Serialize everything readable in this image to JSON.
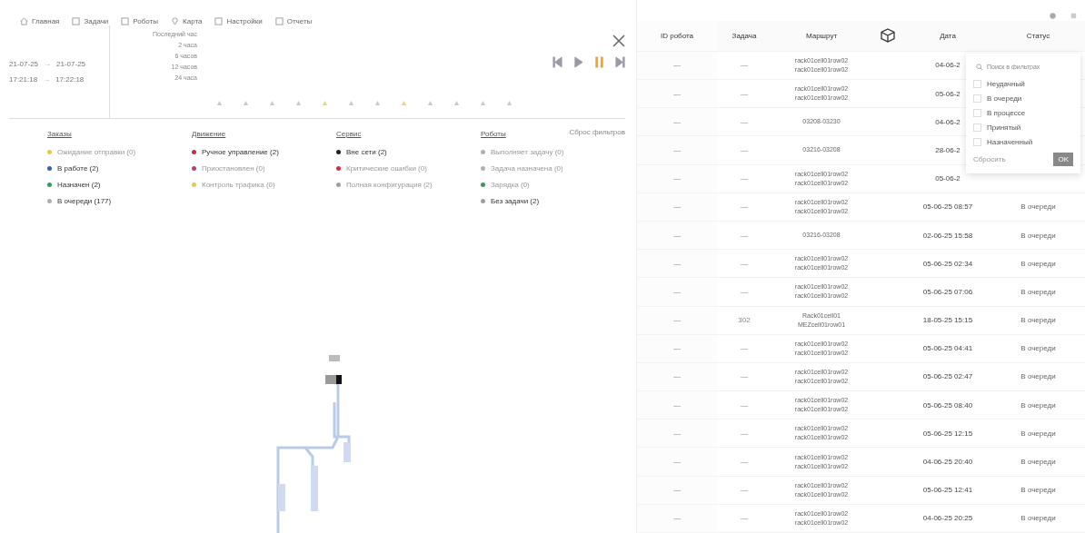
{
  "nav": [
    {
      "kind": "home",
      "label": "Главная"
    },
    {
      "kind": "tasks",
      "label": "Задачи"
    },
    {
      "kind": "robots",
      "label": "Роботы"
    },
    {
      "kind": "map",
      "label": "Карта"
    },
    {
      "kind": "settings",
      "label": "Настройки"
    },
    {
      "kind": "reports",
      "label": "Отчеты"
    }
  ],
  "range": {
    "from_date": "21-07-25",
    "to_date": "21-07-25",
    "from_time": "17:21:18",
    "to_time": "17:22:18",
    "arrow": "→"
  },
  "periods": [
    "Последний час",
    "2 часа",
    "6 часов",
    "12 часов",
    "24 часа"
  ],
  "timeline": [
    {
      "color": "#c8c8c8"
    },
    {
      "color": "#c8c8c8"
    },
    {
      "color": "#c8c8c8"
    },
    {
      "color": "#c8c8c8"
    },
    {
      "color": "#e8d870"
    },
    {
      "color": "#c8c8c8"
    },
    {
      "color": "#c8c8c8"
    },
    {
      "color": "#e8d870"
    },
    {
      "color": "#c8c8c8"
    },
    {
      "color": "#c8c8c8"
    },
    {
      "color": "#c8c8c8"
    },
    {
      "color": "#c8c8c8"
    }
  ],
  "player": [
    {
      "kind": "first",
      "selected": false
    },
    {
      "kind": "play",
      "selected": false
    },
    {
      "kind": "pause",
      "selected": true
    },
    {
      "kind": "last",
      "selected": false
    }
  ],
  "reset_filters": "Сброс фильтров",
  "filter_groups": [
    {
      "title": "Заказы",
      "items": [
        {
          "label": "Ожидание отправки (0)",
          "active": false,
          "color": "#e6c84a"
        },
        {
          "label": "В работе (2)",
          "active": true,
          "color": "#3b5bb5"
        },
        {
          "label": "Назначен (2)",
          "active": true,
          "color": "#3a9a5a"
        },
        {
          "label": "В очереди (177)",
          "active": true,
          "color": "#b0b0b0"
        }
      ]
    },
    {
      "title": "Движение",
      "items": [
        {
          "label": "Ручное управление (2)",
          "active": true,
          "color": "#c03040"
        },
        {
          "label": "Приостановлен (0)",
          "active": false,
          "color": "#c04060"
        },
        {
          "label": "Контроль трафика (0)",
          "active": false,
          "color": "#e6c84a"
        }
      ]
    },
    {
      "title": "Сервис",
      "items": [
        {
          "label": "Вне сети (2)",
          "active": true,
          "color": "#202020"
        },
        {
          "label": "Критические ошибки (0)",
          "active": false,
          "color": "#d03040"
        },
        {
          "label": "Полная конфигурация (2)",
          "active": false,
          "color": "#a0a0a0"
        }
      ]
    },
    {
      "title": "Роботы",
      "items": [
        {
          "label": "Выполняет задачу (0)",
          "active": false,
          "color": "#b0b0b0"
        },
        {
          "label": "Задача назначена (0)",
          "active": false,
          "color": "#b0b0b0"
        },
        {
          "label": "Зарядка (0)",
          "active": false,
          "color": "#3a9a5a"
        },
        {
          "label": "Без задачи (2)",
          "active": true,
          "color": "#a0a0a0"
        }
      ]
    }
  ],
  "table": {
    "columns": [
      "ID робота",
      "Задача",
      "Маршрут",
      "Дата",
      "Статус"
    ],
    "rows": [
      {
        "robot": "—",
        "task": "—",
        "route": [
          "rack01cell01row02",
          "rack01cell01row02"
        ],
        "date": "04-06-2",
        "status": ""
      },
      {
        "robot": "—",
        "task": "—",
        "route": [
          "rack01cell01row02",
          "rack01cell01row02"
        ],
        "date": "05-06-2",
        "status": ""
      },
      {
        "robot": "—",
        "task": "—",
        "route": [
          "03208-03230"
        ],
        "date": "04-06-2",
        "status": ""
      },
      {
        "robot": "—",
        "task": "—",
        "route": [
          "03216-03208"
        ],
        "date": "28-06-2",
        "status": ""
      },
      {
        "robot": "—",
        "task": "—",
        "route": [
          "rack01cell01row02",
          "rack01cell01row02"
        ],
        "date": "05-06-2",
        "status": ""
      },
      {
        "robot": "—",
        "task": "—",
        "route": [
          "rack01cell01row02",
          "rack01cell01row02"
        ],
        "date": "05-06-25 08:57",
        "status": "В очереди"
      },
      {
        "robot": "—",
        "task": "—",
        "route": [
          "03216-03208"
        ],
        "date": "02-06-25 15:58",
        "status": "В очереди"
      },
      {
        "robot": "—",
        "task": "—",
        "route": [
          "rack01cell01row02",
          "rack01cell01row02"
        ],
        "date": "05-06-25 02:34",
        "status": "В очереди"
      },
      {
        "robot": "—",
        "task": "—",
        "route": [
          "rack01cell01row02",
          "rack01cell01row02"
        ],
        "date": "05-06-25 07:06",
        "status": "В очереди"
      },
      {
        "robot": "—",
        "task": "302",
        "route": [
          "Rack01cell01",
          "MEZcell01row01"
        ],
        "date": "18-05-25 15:15",
        "status": "В очереди"
      },
      {
        "robot": "—",
        "task": "—",
        "route": [
          "rack01cell01row02",
          "rack01cell01row02"
        ],
        "date": "05-06-25 04:41",
        "status": "В очереди"
      },
      {
        "robot": "—",
        "task": "—",
        "route": [
          "rack01cell01row02",
          "rack01cell01row02"
        ],
        "date": "05-06-25 02:47",
        "status": "В очереди"
      },
      {
        "robot": "—",
        "task": "—",
        "route": [
          "rack01cell01row02",
          "rack01cell01row02"
        ],
        "date": "05-06-25 08:40",
        "status": "В очереди"
      },
      {
        "robot": "—",
        "task": "—",
        "route": [
          "rack01cell01row02",
          "rack01cell01row02"
        ],
        "date": "05-06-25 12:15",
        "status": "В очереди"
      },
      {
        "robot": "—",
        "task": "—",
        "route": [
          "rack01cell01row02",
          "rack01cell01row02"
        ],
        "date": "04-06-25 20:40",
        "status": "В очереди"
      },
      {
        "robot": "—",
        "task": "—",
        "route": [
          "rack01cell01row02",
          "rack01cell01row02"
        ],
        "date": "05-06-25 12:41",
        "status": "В очереди"
      },
      {
        "robot": "—",
        "task": "—",
        "route": [
          "rack01cell01row02",
          "rack01cell01row02"
        ],
        "date": "04-06-25 20:25",
        "status": "В очереди"
      }
    ]
  },
  "status_filter": {
    "placeholder": "Поиск в фильтрах",
    "options": [
      {
        "label": "Неудачный",
        "checked": false
      },
      {
        "label": "В очереди",
        "checked": false
      },
      {
        "label": "В процессе",
        "checked": false
      },
      {
        "label": "Принятый",
        "checked": false
      },
      {
        "label": "Назначенный",
        "checked": false
      }
    ],
    "reset": "Сбросить",
    "ok": "OK"
  }
}
